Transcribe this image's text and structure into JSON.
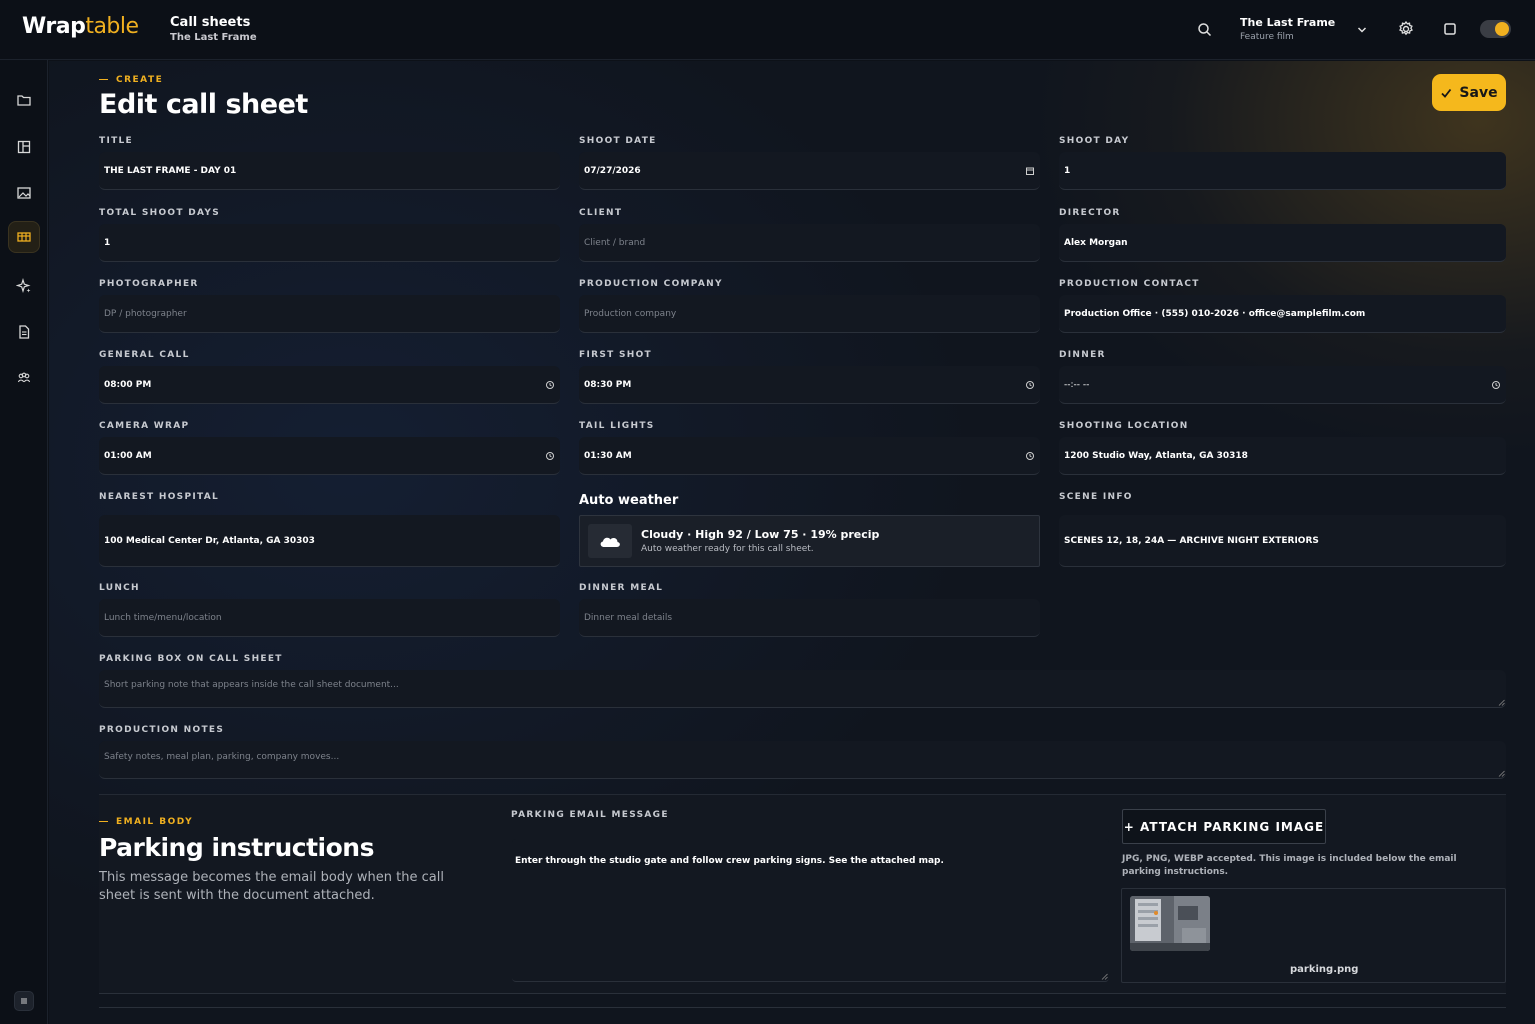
{
  "app": {
    "logo_word": "Wrap",
    "logo_accent": "table"
  },
  "header": {
    "page": "Call sheets",
    "project": "The Last Frame",
    "project_switcher": {
      "name": "The Last Frame",
      "type": "Feature film"
    },
    "icons": [
      "search-icon",
      "gear-icon",
      "square-icon",
      "theme-toggle"
    ]
  },
  "sidebar": {
    "items": [
      {
        "icon": "folder-icon",
        "active": false
      },
      {
        "icon": "board-icon",
        "active": false
      },
      {
        "icon": "image-icon",
        "active": false
      },
      {
        "icon": "call-sheet-icon",
        "active": true
      },
      {
        "icon": "sparkle-icon",
        "active": false
      },
      {
        "icon": "document-icon",
        "active": false
      },
      {
        "icon": "team-icon",
        "active": false
      }
    ],
    "bottom_icon": "menu-icon"
  },
  "form": {
    "eyebrow": "CREATE",
    "title": "Edit call sheet",
    "save_label": "Save",
    "fields": {
      "title": {
        "label": "TITLE",
        "value": "THE LAST FRAME - DAY 01"
      },
      "shoot_date": {
        "label": "SHOOT DATE",
        "value": "07/27/2026"
      },
      "shoot_day": {
        "label": "SHOOT DAY",
        "value": "1"
      },
      "total_shoot_days": {
        "label": "TOTAL SHOOT DAYS",
        "value": "1"
      },
      "client": {
        "label": "CLIENT",
        "placeholder": "Client / brand"
      },
      "director": {
        "label": "DIRECTOR",
        "value": "Alex Morgan"
      },
      "photographer": {
        "label": "PHOTOGRAPHER",
        "placeholder": "DP / photographer"
      },
      "production_company": {
        "label": "PRODUCTION COMPANY",
        "placeholder": "Production company"
      },
      "production_contact": {
        "label": "PRODUCTION CONTACT",
        "value": "Production Office · (555) 010-2026 · office@samplefilm.com"
      },
      "general_call": {
        "label": "GENERAL CALL",
        "value": "08:00 PM"
      },
      "first_shot": {
        "label": "FIRST SHOT",
        "value": "08:30 PM"
      },
      "dinner": {
        "label": "DINNER",
        "value": "--:-- --"
      },
      "camera_wrap": {
        "label": "CAMERA WRAP",
        "value": "01:00 AM"
      },
      "tail_lights": {
        "label": "TAIL LIGHTS",
        "value": "01:30 AM"
      },
      "shooting_location": {
        "label": "SHOOTING LOCATION",
        "value": "1200 Studio Way, Atlanta, GA 30318"
      },
      "nearest_hospital": {
        "label": "NEAREST HOSPITAL",
        "value": "100 Medical Center Dr, Atlanta, GA 30303"
      },
      "scene_info": {
        "label": "SCENE INFO",
        "value": "SCENES 12, 18, 24A — ARCHIVE NIGHT EXTERIORS"
      },
      "lunch": {
        "label": "LUNCH",
        "placeholder": "Lunch time/menu/location"
      },
      "dinner_meal": {
        "label": "DINNER MEAL",
        "placeholder": "Dinner meal details"
      },
      "parking_box": {
        "label": "PARKING BOX ON CALL SHEET",
        "placeholder": "Short parking note that appears inside the call sheet document..."
      },
      "production_notes": {
        "label": "PRODUCTION NOTES",
        "placeholder": "Safety notes, meal plan, parking, company moves..."
      }
    },
    "weather": {
      "heading": "Auto weather",
      "summary": "Cloudy · High 92 / Low 75 · 19% precip",
      "status": "Auto weather ready for this call sheet."
    }
  },
  "email": {
    "eyebrow": "EMAIL BODY",
    "title": "Parking instructions",
    "description": "This message becomes the email body when the call sheet is sent with the document attached.",
    "message_label": "PARKING EMAIL MESSAGE",
    "message_value": "Enter through the studio gate and follow crew parking signs. See the attached map.",
    "attach_label": "+ ATTACH PARKING IMAGE",
    "attach_note": "JPG, PNG, WEBP accepted. This image is included below the email parking instructions.",
    "attachment_name": "parking.png"
  },
  "colors": {
    "accent": "#f5b81c",
    "background": "#10151e",
    "field": "#131821"
  }
}
